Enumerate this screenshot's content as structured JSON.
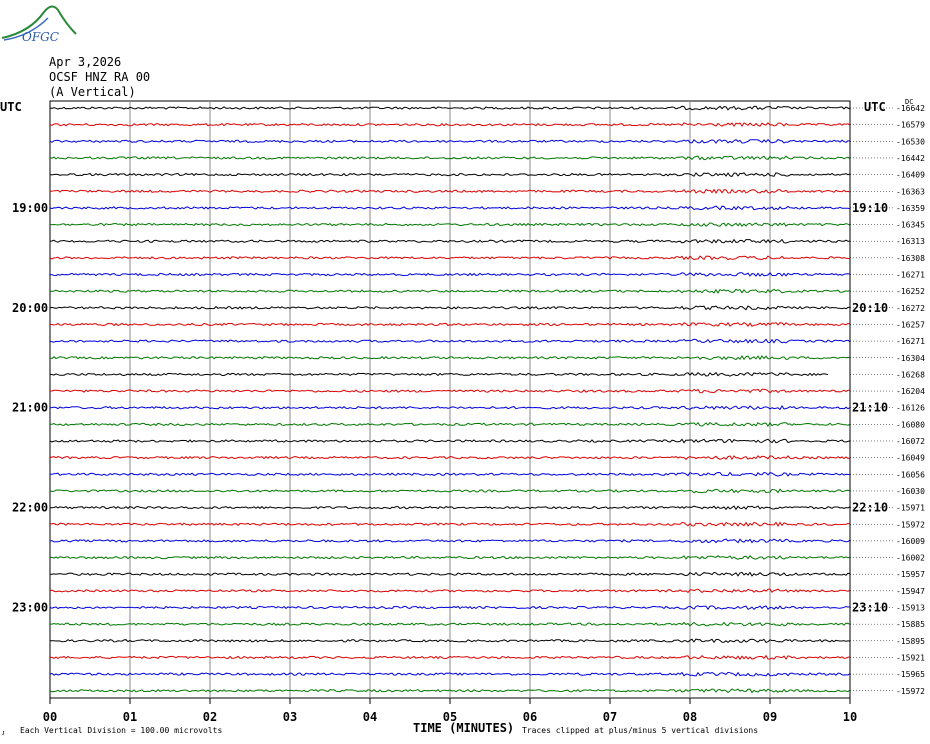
{
  "header": {
    "date": "Apr 3,2026",
    "station": "OCSF HNZ RA 00",
    "component": "(A Vertical)",
    "logo_text": "OFGC"
  },
  "chart_data": {
    "type": "line",
    "title": "",
    "xlabel": "TIME (MINUTES)",
    "x_ticks": [
      "00",
      "01",
      "02",
      "03",
      "04",
      "05",
      "06",
      "07",
      "08",
      "09",
      "10"
    ],
    "xlim": [
      0,
      10
    ],
    "left_axis_label": "UTC",
    "right_axis_label": "UTC",
    "dc_label": "DC",
    "left_hour_labels": [
      {
        "row": 6,
        "label": "19:00"
      },
      {
        "row": 12,
        "label": "20:00"
      },
      {
        "row": 18,
        "label": "21:00"
      },
      {
        "row": 24,
        "label": "22:00"
      },
      {
        "row": 30,
        "label": "23:00"
      }
    ],
    "right_hour_labels": [
      {
        "row": 6,
        "label": "19:10"
      },
      {
        "row": 12,
        "label": "20:10"
      },
      {
        "row": 18,
        "label": "21:10"
      },
      {
        "row": 24,
        "label": "22:10"
      },
      {
        "row": 30,
        "label": "23:10"
      }
    ],
    "trace_colors": [
      "#000000",
      "#dd0000",
      "#0000dd",
      "#007700"
    ],
    "dc_offsets": [
      -16642,
      -16579,
      -16530,
      -16442,
      -16409,
      -16363,
      -16359,
      -16345,
      -16313,
      -16308,
      -16271,
      -16252,
      -16272,
      -16257,
      -16271,
      -16304,
      -16268,
      -16204,
      -16126,
      -16080,
      -16072,
      -16049,
      -16056,
      -16030,
      -15971,
      -15972,
      -16009,
      -16002,
      -15957,
      -15947,
      -15913,
      -15885,
      -15895,
      -15921,
      -15965,
      -15972
    ],
    "footer_left": "Each Vertical Division =  100.00 microvolts",
    "footer_right": "Traces clipped at plus/minus 5 vertical divisions",
    "corner_mark": "ᴊ"
  }
}
